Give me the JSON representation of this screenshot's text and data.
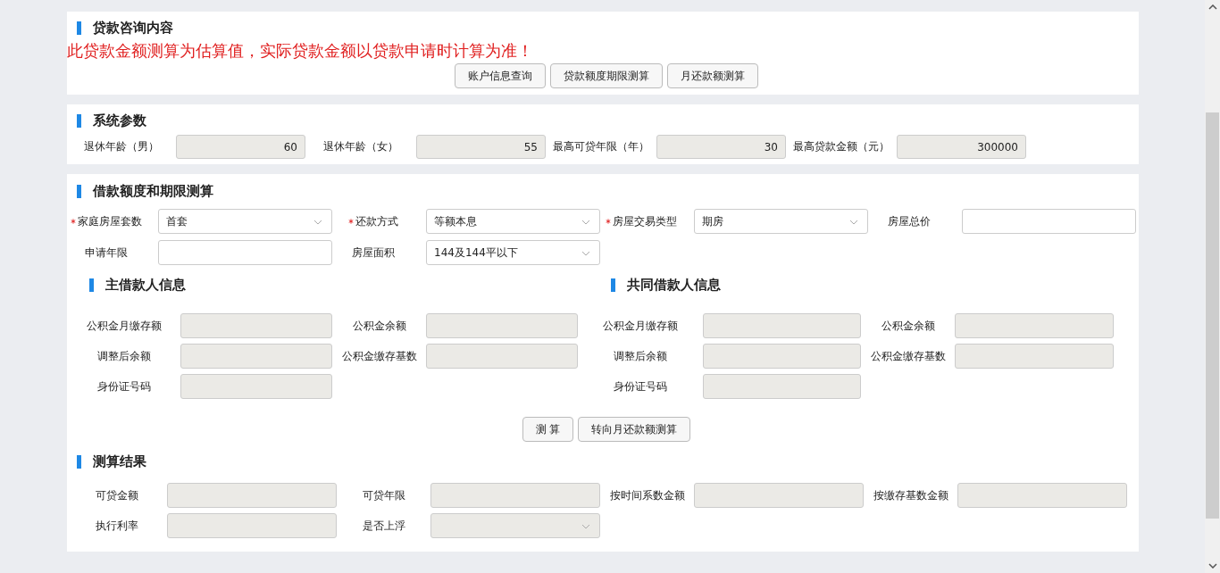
{
  "consult": {
    "title": "贷款咨询内容",
    "notice": "此贷款金额测算为估算值，实际贷款金额以贷款申请时计算为准！",
    "buttons": [
      "账户信息查询",
      "贷款额度期限测算",
      "月还款额测算"
    ]
  },
  "params": {
    "title": "系统参数",
    "fields": [
      {
        "label": "退休年龄（男）",
        "value": "60",
        "disabled": true
      },
      {
        "label": "退休年龄（女）",
        "value": "55",
        "disabled": true
      },
      {
        "label": "最高可贷年限（年）",
        "value": "30",
        "disabled": true
      },
      {
        "label": "最高贷款金额（元）",
        "value": "300000",
        "disabled": true
      }
    ]
  },
  "calc": {
    "title": "借款额度和期限测算",
    "fields": [
      {
        "label": "家庭房屋套数",
        "kind": "select",
        "value": "首套",
        "required": true,
        "disabled": false
      },
      {
        "label": "还款方式",
        "kind": "select",
        "value": "等额本息",
        "required": true,
        "disabled": false
      },
      {
        "label": "房屋交易类型",
        "kind": "select",
        "value": "期房",
        "required": true,
        "disabled": false
      },
      {
        "label": "房屋总价",
        "kind": "input",
        "required": false,
        "disabled": false
      },
      {
        "label": "申请年限",
        "kind": "input",
        "required": false,
        "disabled": false
      },
      {
        "label": "房屋面积",
        "kind": "select",
        "value": "144及144平以下",
        "required": false,
        "disabled": false
      }
    ],
    "main_borrower": {
      "title": "主借款人信息",
      "fields": [
        {
          "label": "公积金月缴存额",
          "disabled": true
        },
        {
          "label": "公积金余额",
          "disabled": true
        },
        {
          "label": "调整后余额",
          "disabled": true
        },
        {
          "label": "公积金缴存基数",
          "disabled": true
        },
        {
          "label": "身份证号码",
          "disabled": true
        }
      ]
    },
    "co_borrower": {
      "title": "共同借款人信息",
      "fields": [
        {
          "label": "公积金月缴存额",
          "disabled": true
        },
        {
          "label": "公积金余额",
          "disabled": true
        },
        {
          "label": "调整后余额",
          "disabled": true
        },
        {
          "label": "公积金缴存基数",
          "disabled": true
        },
        {
          "label": "身份证号码",
          "disabled": true
        }
      ]
    },
    "buttons": [
      "测 算",
      "转向月还款额测算"
    ]
  },
  "results": {
    "title": "测算结果",
    "fields": [
      {
        "label": "可贷金额",
        "kind": "input",
        "disabled": true
      },
      {
        "label": "可贷年限",
        "kind": "input",
        "disabled": true
      },
      {
        "label": "按时间系数金额",
        "kind": "input",
        "disabled": true
      },
      {
        "label": "按缴存基数金额",
        "kind": "input",
        "disabled": true
      },
      {
        "label": "执行利率",
        "kind": "input",
        "disabled": true
      },
      {
        "label": "是否上浮",
        "kind": "select",
        "disabled": true
      }
    ]
  }
}
